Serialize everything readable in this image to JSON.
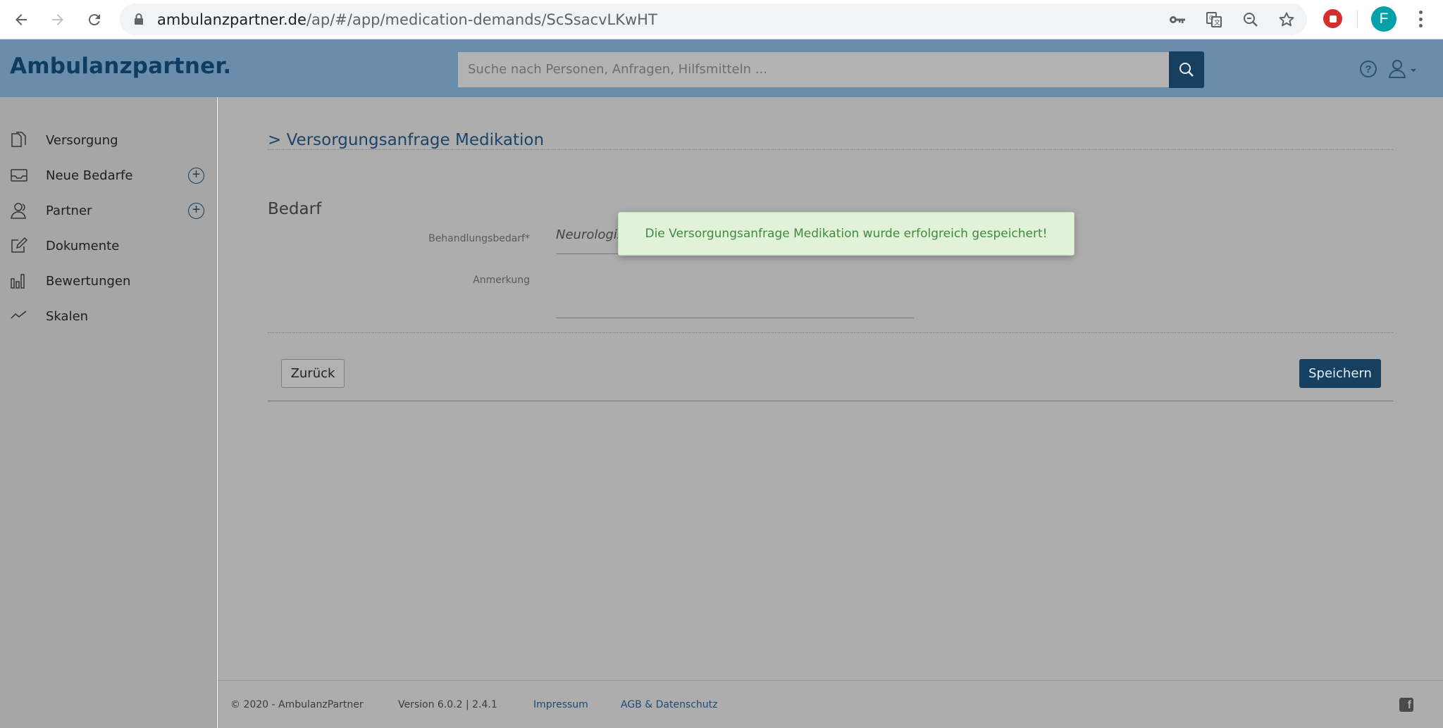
{
  "browser": {
    "url_host": "ambulanzpartner.de",
    "url_path": "/ap/#/app/medication-demands/ScSsacvLKwHT",
    "profile_initial": "F",
    "icons": [
      "back-arrow-icon",
      "forward-arrow-icon",
      "reload-icon",
      "lock-icon",
      "key-icon",
      "translate-icon",
      "zoom-icon",
      "star-icon",
      "stop-extension-icon",
      "menu-icon"
    ]
  },
  "header": {
    "logo": "Ambulanzpartner.",
    "search_placeholder": "Suche nach Personen, Anfragen, Hilfsmitteln ...",
    "help_glyph": "?"
  },
  "sidebar": {
    "items": [
      {
        "label": "Versorgung",
        "icon": "documents-icon",
        "has_add": false
      },
      {
        "label": "Neue Bedarfe",
        "icon": "inbox-icon",
        "has_add": true
      },
      {
        "label": "Partner",
        "icon": "partner-icon",
        "has_add": true
      },
      {
        "label": "Dokumente",
        "icon": "edit-icon",
        "has_add": false
      },
      {
        "label": "Bewertungen",
        "icon": "bar-chart-icon",
        "has_add": false
      },
      {
        "label": "Skalen",
        "icon": "trend-icon",
        "has_add": false
      }
    ],
    "add_glyph": "+"
  },
  "main": {
    "section_chevron": ">",
    "section_title": "Versorgungsanfrage Medikation",
    "subheading": "Bedarf",
    "fields": {
      "behandlung_label": "Behandlungsbedarf*",
      "behandlung_value": "Neurologische",
      "anmerkung_label": "Anmerkung",
      "anmerkung_value": ""
    },
    "back_button": "Zurück",
    "save_button": "Speichern"
  },
  "toast": {
    "message": "Die Versorgungsanfrage Medikation wurde erfolgreich gespeichert!"
  },
  "footer": {
    "copyright": "© 2020 - AmbulanzPartner",
    "version": "Version 6.0.2 | 2.4.1",
    "impressum": "Impressum",
    "agb": "AGB & Datenschutz",
    "social_glyph": "f"
  },
  "colors": {
    "header_bg": "#6a8dab",
    "brand_dark": "#173f60",
    "overlay_gray": "#adadad",
    "toast_bg": "#e1f2d9",
    "toast_text": "#3f8a3f"
  }
}
